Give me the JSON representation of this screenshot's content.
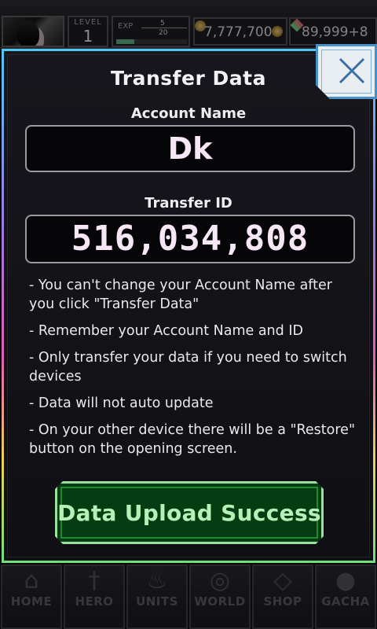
{
  "hud": {
    "level_label": "LEVEL",
    "level_value": "1",
    "exp_label": "EXP",
    "exp_current": "5",
    "exp_max": "20",
    "exp_progress": 0.25,
    "coins": "7,777,700",
    "gems": "89,999+8"
  },
  "dialog": {
    "title": "Transfer Data",
    "account_label": "Account Name",
    "account_value": "Dk",
    "transfer_label": "Transfer ID",
    "transfer_value": "516,034,808",
    "notes": [
      "- You can't change your Account Name after you click \"Transfer Data\"",
      "- Remember your Account Name and ID",
      "- Only transfer your data if you need to switch devices",
      "- Data will not auto update",
      "- On your other device there will be a \"Restore\" button on the opening screen."
    ],
    "button_label": "Data Upload Success"
  },
  "nav": {
    "items": [
      {
        "label": "HOME",
        "icon": "home-icon"
      },
      {
        "label": "HERO",
        "icon": "sword-icon"
      },
      {
        "label": "UNITS",
        "icon": "flame-icon"
      },
      {
        "label": "WORLD",
        "icon": "globe-icon"
      },
      {
        "label": "SHOP",
        "icon": "gem-icon"
      },
      {
        "label": "GACHA",
        "icon": "orb-icon"
      }
    ]
  },
  "colors": {
    "accent_green": "#063c12",
    "close_blue": "#4a90c8"
  }
}
